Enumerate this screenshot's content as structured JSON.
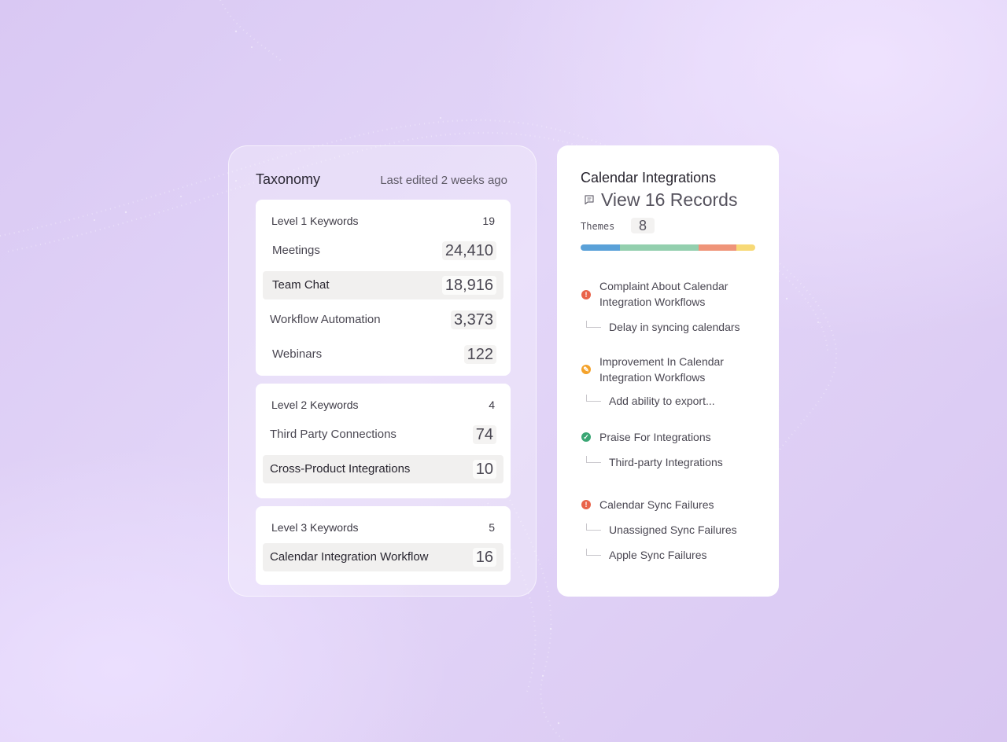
{
  "taxonomy": {
    "title": "Taxonomy",
    "last_edited": "Last edited 2 weeks ago",
    "level1": {
      "heading": "Level 1 Keywords",
      "count": "19",
      "rows": [
        {
          "label": "Meetings",
          "value": "24,410"
        },
        {
          "label": "Team Chat",
          "value": "18,916"
        },
        {
          "label": "Workflow Automation",
          "value": "3,373"
        },
        {
          "label": "Webinars",
          "value": "122"
        }
      ]
    },
    "level2": {
      "heading": "Level 2 Keywords",
      "count": "4",
      "rows": [
        {
          "label": "Third Party Connections",
          "value": "74"
        },
        {
          "label": "Cross-Product Integrations",
          "value": "10"
        }
      ]
    },
    "level3": {
      "heading": "Level 3 Keywords",
      "count": "5",
      "rows": [
        {
          "label": "Calendar Integration Workflow",
          "value": "16"
        }
      ]
    }
  },
  "detail": {
    "title": "Calendar Integrations",
    "records_label": "View 16 Records",
    "records_icon": "message-icon",
    "themes_label": "Themes",
    "themes_count": "8",
    "bar_colors": [
      "#5aa1d8",
      "#93cfae",
      "#ef9479",
      "#f7d976"
    ],
    "themes": [
      {
        "icon": "alert-icon",
        "color": "#e9634a",
        "text": "Complaint About Calendar Integration Workflows",
        "subs": [
          "Delay in syncing calendars"
        ]
      },
      {
        "icon": "lightbulb-icon",
        "color": "#f4a22a",
        "text": "Improvement In Calendar Integration Workflows",
        "subs": [
          "Add ability to export..."
        ]
      },
      {
        "icon": "check-icon",
        "color": "#3aa674",
        "text": "Praise For Integrations",
        "subs": [
          "Third-party Integrations"
        ]
      },
      {
        "icon": "alert-icon",
        "color": "#e9634a",
        "text": "Calendar Sync Failures",
        "subs": [
          "Unassigned Sync Failures",
          "Apple Sync Failures"
        ]
      }
    ]
  }
}
